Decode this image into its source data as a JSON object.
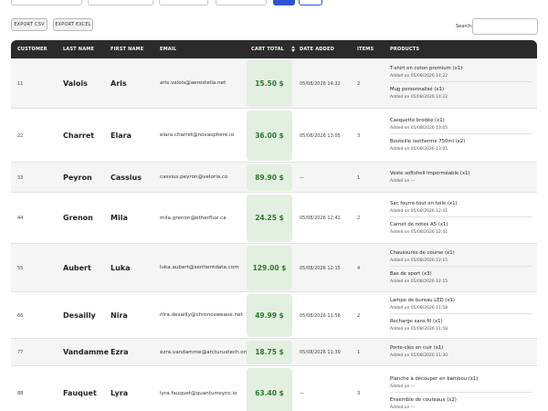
{
  "toolbar": {
    "export_csv": "EXPORT CSV",
    "export_excel": "EXPORT EXCEL",
    "search_label": "Search:",
    "search_value": ""
  },
  "columns": {
    "customer": "CUSTOMER",
    "last_name": "LAST NAME",
    "first_name": "FIRST NAME",
    "email": "EMAIL",
    "cart_total": "CART TOTAL",
    "date_added": "DATE ADDED",
    "items": "ITEMS",
    "products": "PRODUCTS"
  },
  "rows": [
    {
      "id": "11",
      "last": "Valois",
      "first": "Aris",
      "email": "aris.valois@aerostella.net",
      "total": "15.50 $",
      "date": "05/08/2026 14:22",
      "items": "2",
      "products": [
        {
          "name": "T-shirt en coton premium (x1)",
          "added": "Added on 05/08/2026 14:22"
        },
        {
          "name": "Mug personnalisé (x1)",
          "added": "Added on 05/08/2026 14:22"
        }
      ]
    },
    {
      "id": "22",
      "last": "Charret",
      "first": "Elara",
      "email": "elara.charret@novasphere.io",
      "total": "36.00 $",
      "date": "05/08/2026 13:05",
      "items": "3",
      "products": [
        {
          "name": "Casquette brodée (x1)",
          "added": "Added on 05/08/2026 13:05"
        },
        {
          "name": "Bouteille isotherme 750ml (x2)",
          "added": "Added on 05/08/2026 13:05"
        }
      ]
    },
    {
      "id": "33",
      "last": "Peyron",
      "first": "Cassius",
      "email": "cassius.peyron@veloria.co",
      "total": "89.90 $",
      "date": "—",
      "items": "1",
      "products": [
        {
          "name": "Veste softshell imperméable (x1)",
          "added": "Added on —"
        }
      ]
    },
    {
      "id": "44",
      "last": "Grenon",
      "first": "Mila",
      "email": "mila.grenon@etherflux.ca",
      "total": "24.25 $",
      "date": "05/08/2026 12:41",
      "items": "2",
      "products": [
        {
          "name": "Sac fourre-tout en toile (x1)",
          "added": "Added on 05/08/2026 12:41"
        },
        {
          "name": "Carnet de notes A5 (x1)",
          "added": "Added on 05/08/2026 12:41"
        }
      ]
    },
    {
      "id": "55",
      "last": "Aubert",
      "first": "Luka",
      "email": "luka.aubert@sentientdata.com",
      "total": "129.00 $",
      "date": "05/08/2026 12:15",
      "items": "4",
      "products": [
        {
          "name": "Chaussures de course (x1)",
          "added": "Added on 05/08/2026 12:15"
        },
        {
          "name": "Bas de sport (x3)",
          "added": "Added on 05/08/2026 12:15"
        }
      ]
    },
    {
      "id": "66",
      "last": "Desailly",
      "first": "Nira",
      "email": "nira.desailly@chronosweave.net",
      "total": "49.99 $",
      "date": "05/08/2026 11:58",
      "items": "2",
      "products": [
        {
          "name": "Lampe de bureau LED (x1)",
          "added": "Added on 05/08/2026 11:58"
        },
        {
          "name": "Recharge sans fil (x1)",
          "added": "Added on 05/08/2026 11:58"
        }
      ]
    },
    {
      "id": "77",
      "last": "Vandamme",
      "first": "Ezra",
      "email": "ezra.vandamme@arcturustech.org",
      "total": "18.75 $",
      "date": "05/08/2026 11:30",
      "items": "1",
      "products": [
        {
          "name": "Porte-clés en cuir (x1)",
          "added": "Added on 05/08/2026 11:30"
        }
      ]
    },
    {
      "id": "88",
      "last": "Fauquet",
      "first": "Lyra",
      "email": "lyra.fauquet@quantumsync.io",
      "total": "63.40 $",
      "date": "—",
      "items": "3",
      "products": [
        {
          "name": "Planche à découper en bambou (x1)",
          "added": "Added on —"
        },
        {
          "name": "Ensemble de couteaux (x2)",
          "added": "Added on —"
        }
      ]
    }
  ]
}
